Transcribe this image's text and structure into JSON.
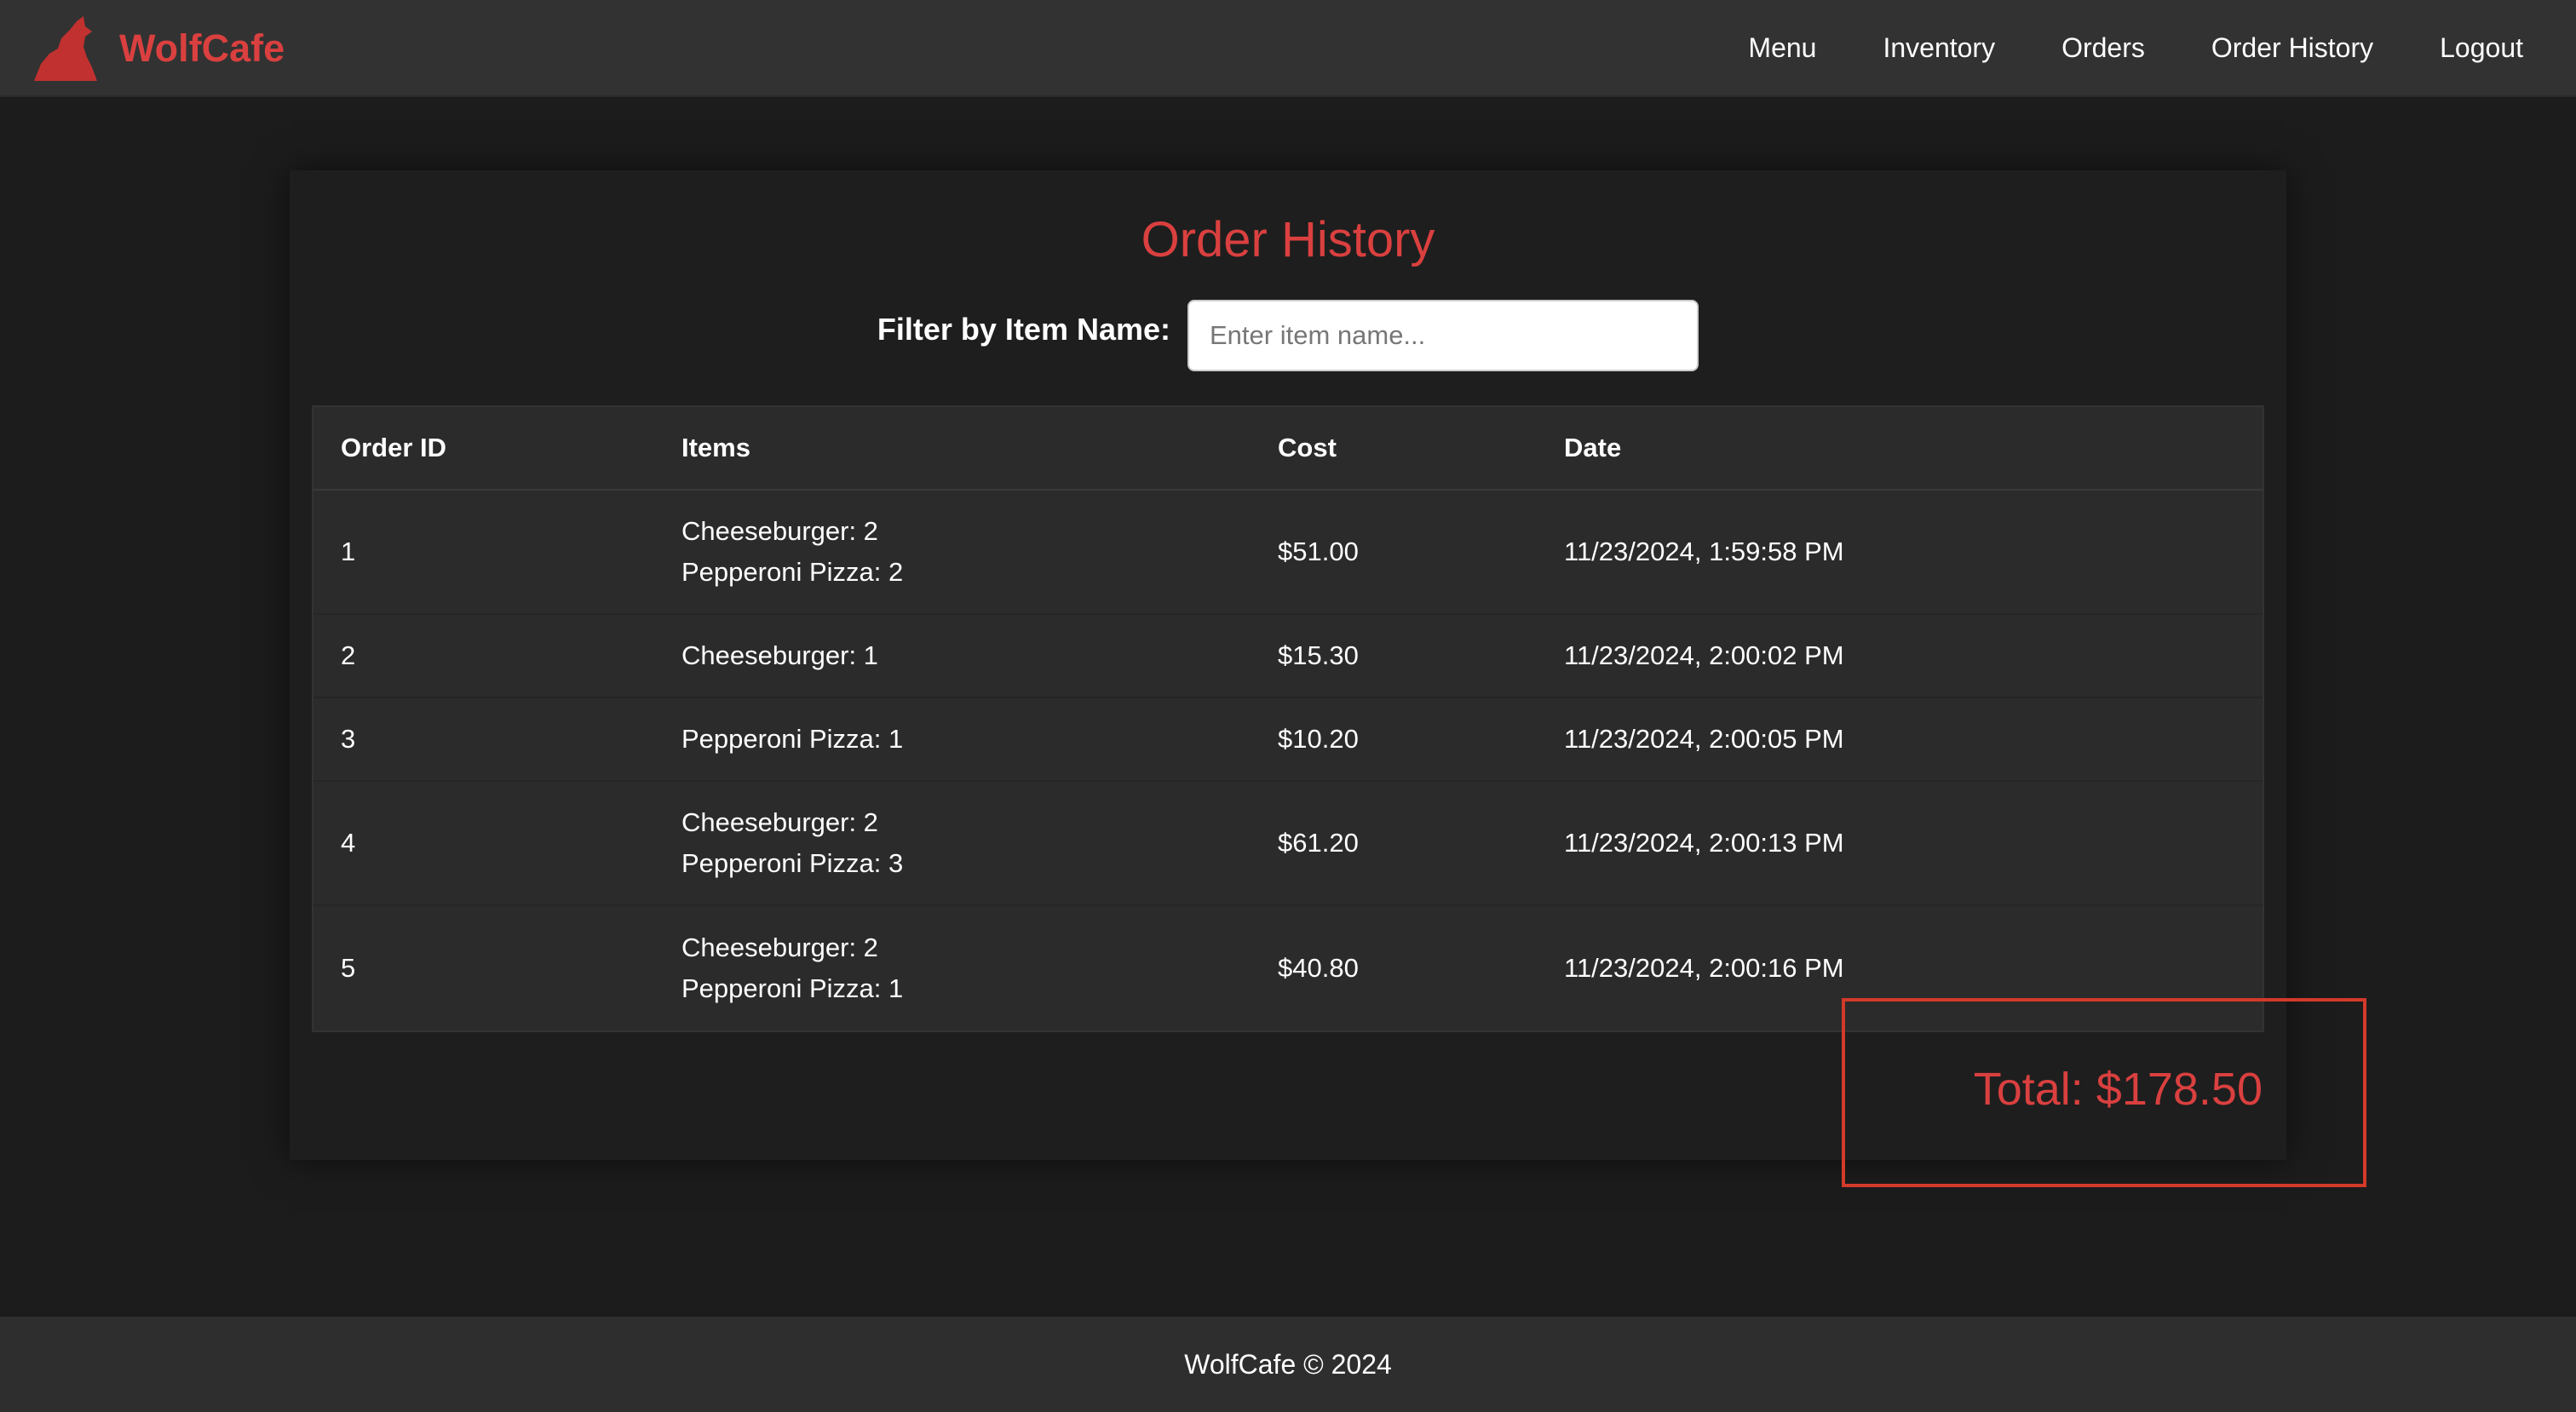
{
  "brand": {
    "name": "WolfCafe",
    "color": "#d9403f"
  },
  "nav": {
    "items": [
      {
        "label": "Menu"
      },
      {
        "label": "Inventory"
      },
      {
        "label": "Orders"
      },
      {
        "label": "Order History"
      },
      {
        "label": "Logout"
      }
    ]
  },
  "page": {
    "title": "Order History",
    "filter": {
      "label": "Filter by Item Name:",
      "placeholder": "Enter item name...",
      "value": ""
    }
  },
  "table": {
    "headers": [
      "Order ID",
      "Items",
      "Cost",
      "Date"
    ],
    "rows": [
      {
        "id": "1",
        "items": [
          "Cheeseburger: 2",
          "Pepperoni Pizza: 2"
        ],
        "cost": "$51.00",
        "date": "11/23/2024, 1:59:58 PM"
      },
      {
        "id": "2",
        "items": [
          "Cheeseburger: 1"
        ],
        "cost": "$15.30",
        "date": "11/23/2024, 2:00:02 PM"
      },
      {
        "id": "3",
        "items": [
          "Pepperoni Pizza: 1"
        ],
        "cost": "$10.20",
        "date": "11/23/2024, 2:00:05 PM"
      },
      {
        "id": "4",
        "items": [
          "Cheeseburger: 2",
          "Pepperoni Pizza: 3"
        ],
        "cost": "$61.20",
        "date": "11/23/2024, 2:00:13 PM"
      },
      {
        "id": "5",
        "items": [
          "Cheeseburger: 2",
          "Pepperoni Pizza: 1"
        ],
        "cost": "$40.80",
        "date": "11/23/2024, 2:00:16 PM"
      }
    ]
  },
  "total": {
    "text": "Total: $178.50"
  },
  "footer": {
    "text": "WolfCafe © 2024"
  },
  "colors": {
    "accent": "#d9403f",
    "highlight_box": "#d23a2a",
    "background": "#1c1c1c",
    "navbar": "#323232"
  },
  "icons": {
    "logo": "wolf-howling-icon"
  }
}
